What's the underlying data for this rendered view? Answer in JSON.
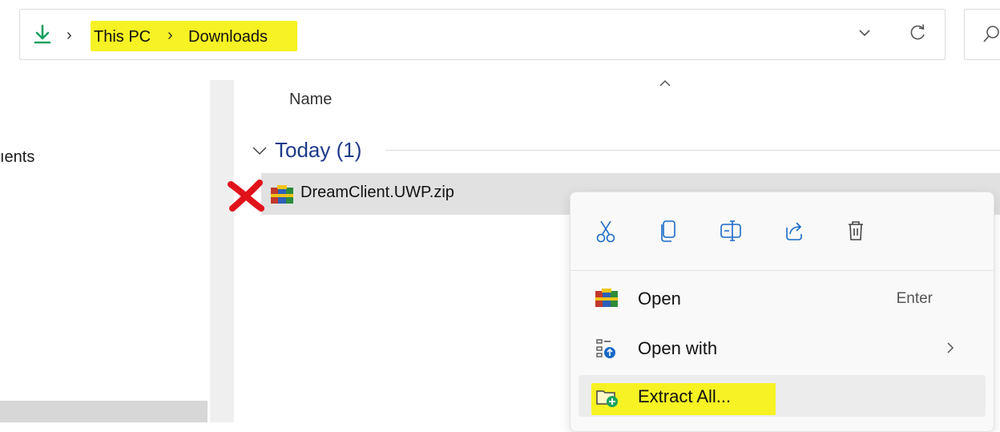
{
  "address_bar": {
    "crumbs": [
      "This PC",
      "Downloads"
    ],
    "separator": "›",
    "location_icon": "download-arrow-icon"
  },
  "nav_pane": {
    "partial_item": "ıents"
  },
  "file_list": {
    "column_header": "Name",
    "group": {
      "label": "Today (1)"
    },
    "files": [
      {
        "name": "DreamClient.UWP.zip",
        "icon": "winrar-archive-icon"
      }
    ]
  },
  "context_menu": {
    "toolbar": [
      "cut-icon",
      "copy-icon",
      "rename-icon",
      "share-icon",
      "delete-icon"
    ],
    "items": [
      {
        "label": "Open",
        "shortcut": "Enter",
        "icon": "winrar-archive-icon"
      },
      {
        "label": "Open with",
        "icon": "open-with-icon",
        "has_submenu": true
      },
      {
        "label": "Extract All...",
        "icon": "extract-folder-icon"
      }
    ]
  },
  "colors": {
    "highlight": "#f7f224",
    "accent_green": "#1aa260",
    "group_text": "#1f3a8a",
    "annotation_red": "#e0121a",
    "accent_blue": "#1769c7"
  }
}
